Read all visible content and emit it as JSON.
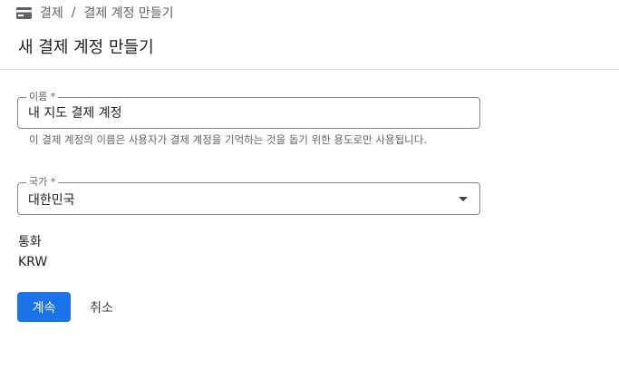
{
  "breadcrumb": {
    "icon": "billing-card-icon",
    "root": "결제",
    "separator": "/",
    "current": "결제 계정 만들기"
  },
  "page": {
    "title": "새 결제 계정 만들기"
  },
  "form": {
    "name": {
      "label": "이름 *",
      "value": "내 지도 결제 계정",
      "hint": "이 결제 계정의 이름은 사용자가 결제 계정을 기억하는 것을 돕기 위한 용도로만 사용됩니다."
    },
    "country": {
      "label": "국가 *",
      "value": "대한민국"
    },
    "currency": {
      "label": "통화",
      "value": "KRW"
    }
  },
  "actions": {
    "continue_label": "계속",
    "cancel_label": "취소"
  },
  "colors": {
    "primary": "#1a73e8",
    "border": "#80868b",
    "divider": "#dadce0"
  }
}
